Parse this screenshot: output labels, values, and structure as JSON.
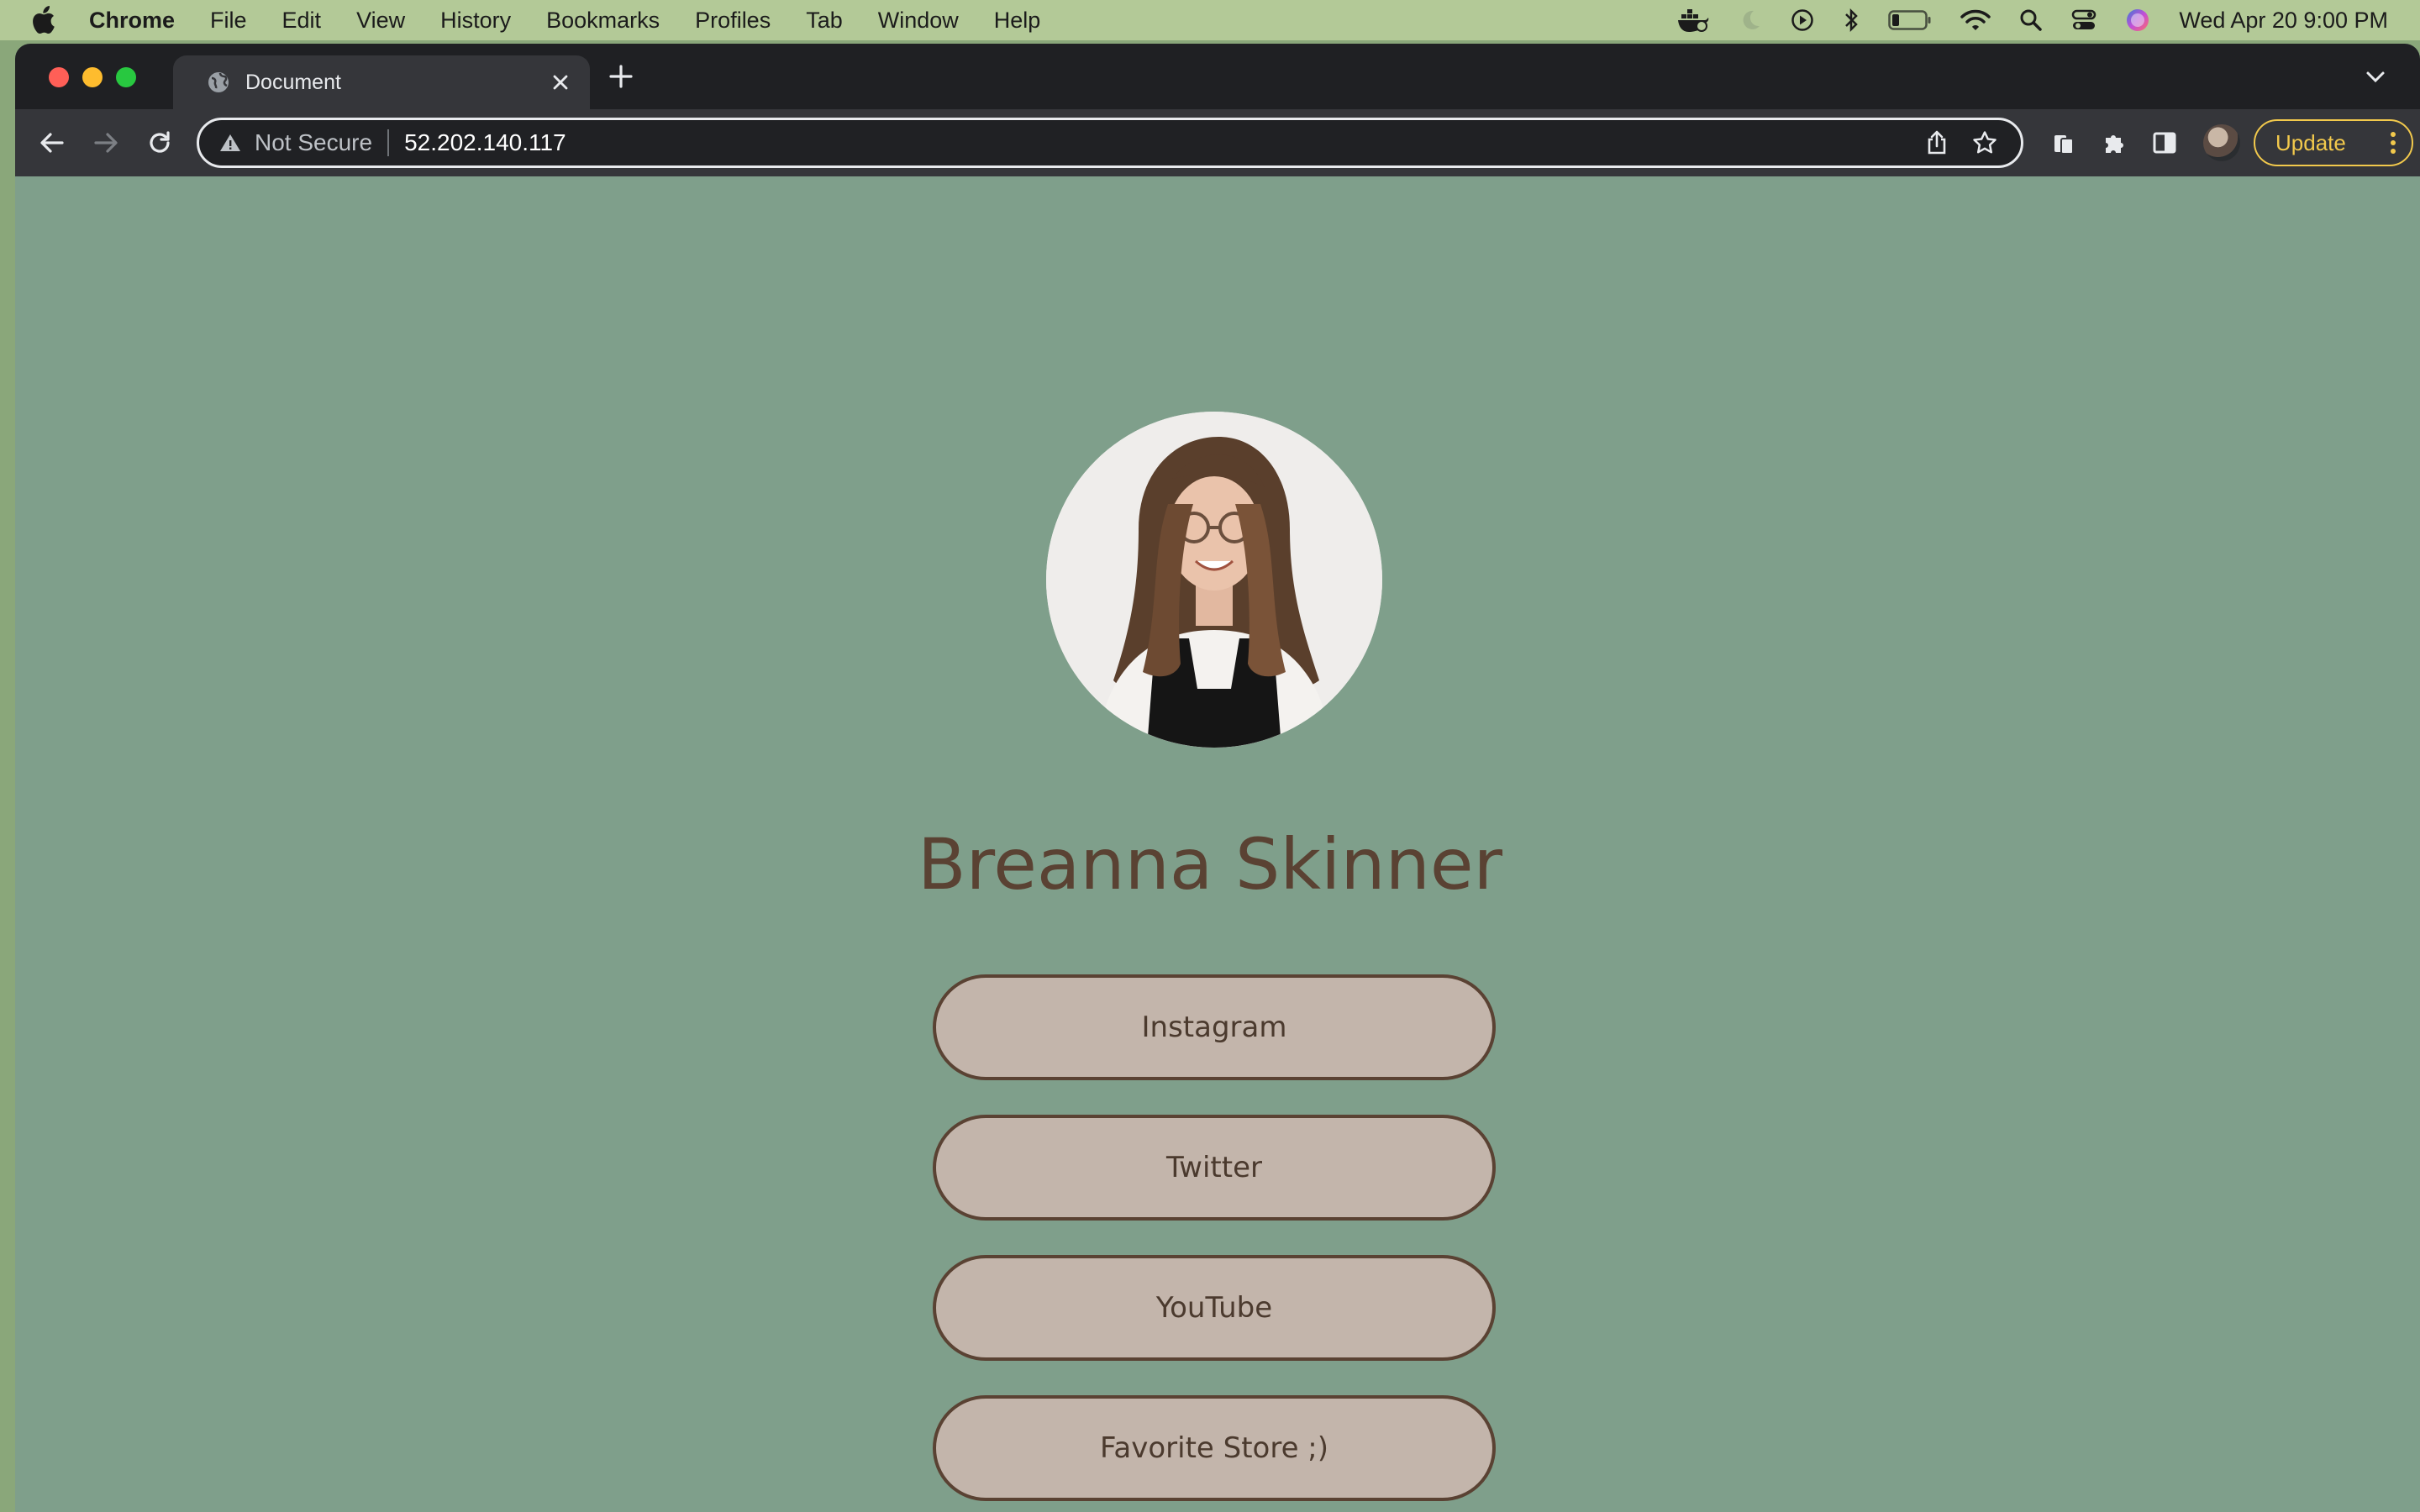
{
  "menubar": {
    "app_name": "Chrome",
    "items": [
      "File",
      "Edit",
      "View",
      "History",
      "Bookmarks",
      "Profiles",
      "Tab",
      "Window",
      "Help"
    ],
    "clock": "Wed Apr 20  9:00 PM"
  },
  "browser": {
    "tab_title": "Document",
    "security_label": "Not Secure",
    "url": "52.202.140.117",
    "update_label": "Update"
  },
  "page": {
    "name": "Breanna Skinner",
    "links": [
      {
        "label": "Instagram"
      },
      {
        "label": "Twitter"
      },
      {
        "label": "YouTube"
      },
      {
        "label": "Favorite Store ;)"
      }
    ]
  },
  "colors": {
    "page_background": "#7f9f8b",
    "button_fill": "#c3b5ab",
    "accent_brown": "#5a4233",
    "update_accent": "#f2c94c"
  }
}
